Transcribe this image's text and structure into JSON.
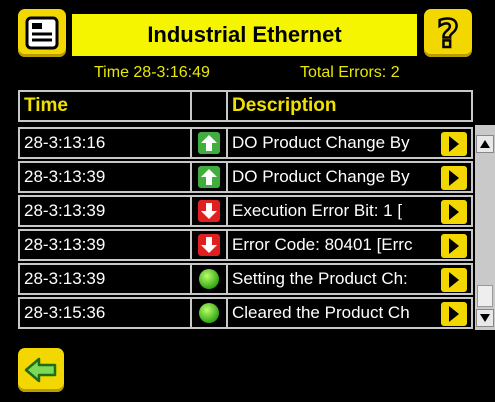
{
  "header": {
    "title": "Industrial Ethernet"
  },
  "status": {
    "time": "Time 28-3:16:49",
    "total_errors": "Total Errors: 2"
  },
  "table": {
    "columns": [
      "Time",
      "",
      "Description"
    ],
    "rows": [
      {
        "time": "28-3:13:16",
        "icon": "up-arrow-icon",
        "description": "DO Product Change By"
      },
      {
        "time": "28-3:13:39",
        "icon": "up-arrow-icon",
        "description": "DO Product Change By"
      },
      {
        "time": "28-3:13:39",
        "icon": "down-arrow-icon",
        "description": "Execution Error Bit: 1 ["
      },
      {
        "time": "28-3:13:39",
        "icon": "down-arrow-icon",
        "description": "Error Code: 80401 [Errc"
      },
      {
        "time": "28-3:13:39",
        "icon": "green-dot-icon",
        "description": "Setting the Product Ch:"
      },
      {
        "time": "28-3:15:36",
        "icon": "green-dot-icon",
        "description": "Cleared the Product Ch"
      }
    ]
  },
  "colors": {
    "accent": "#f2d800",
    "title_bg": "#f5f500",
    "text_yellow": "#e8e800",
    "grid": "#c8c8c8"
  }
}
